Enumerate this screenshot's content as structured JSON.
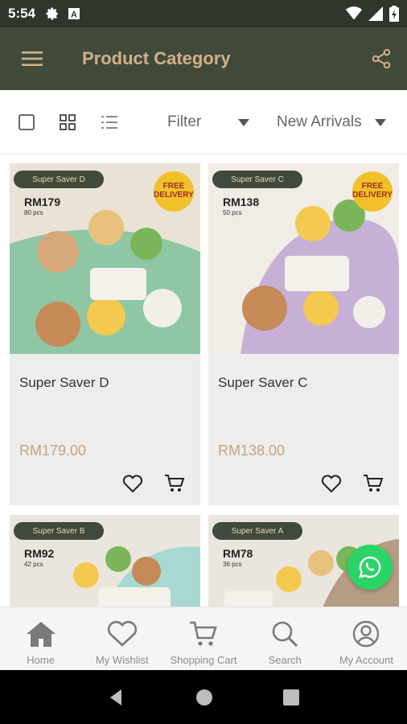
{
  "status_bar": {
    "time": "5:54"
  },
  "app_bar": {
    "title": "Product Category"
  },
  "toolbar": {
    "filter_label": "Filter",
    "sort_label": "New Arrivals"
  },
  "colors": {
    "header": "#414a3a",
    "title": "#d3b08b",
    "price": "#c9a27c",
    "whatsapp": "#2bd466"
  },
  "products": [
    {
      "banner": "Super Saver D",
      "img_price": "RM179",
      "img_pcs": "80 pcs",
      "badge": "FREE DELIVERY",
      "name": "Super Saver D",
      "price": "RM179.00",
      "bg": "#8fc7a5"
    },
    {
      "banner": "Super Saver C",
      "img_price": "RM138",
      "img_pcs": "50 pcs",
      "badge": "FREE DELIVERY",
      "name": "Super Saver C",
      "price": "RM138.00",
      "bg": "#c7b0d6"
    },
    {
      "banner": "Super Saver B",
      "img_price": "RM92",
      "img_pcs": "42 pcs",
      "bg": "#a8d8d2"
    },
    {
      "banner": "Super Saver A",
      "img_price": "RM78",
      "img_pcs": "36 pcs",
      "bg": "#b59c83"
    }
  ],
  "bottom_nav": [
    {
      "label": "Home",
      "icon": "home-icon"
    },
    {
      "label": "My Wishlist",
      "icon": "heart-icon"
    },
    {
      "label": "Shopping Cart",
      "icon": "cart-icon"
    },
    {
      "label": "Search",
      "icon": "search-icon"
    },
    {
      "label": "My Account",
      "icon": "account-icon"
    }
  ]
}
